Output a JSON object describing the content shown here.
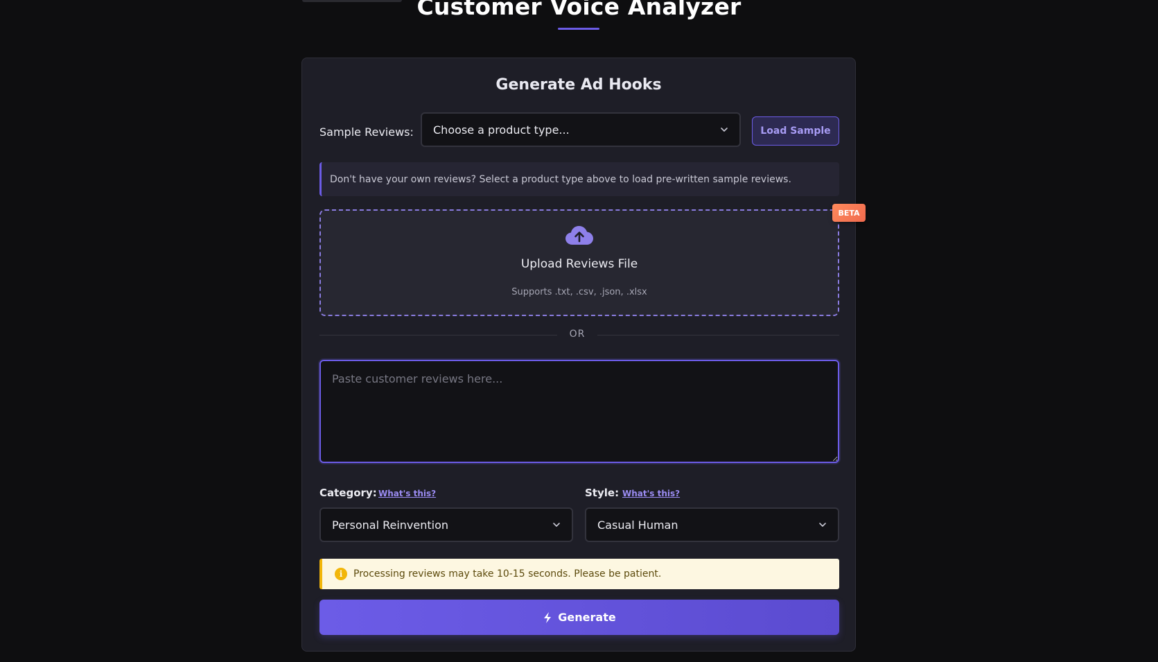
{
  "header": {
    "title": "Customer Voice Analyzer"
  },
  "card": {
    "title": "Generate Ad Hooks",
    "sample": {
      "label": "Sample Reviews:",
      "select_value": "Choose a product type...",
      "load_button": "Load Sample"
    },
    "info_text": "Don't have your own reviews? Select a product type above to load pre-written sample reviews.",
    "upload": {
      "icon": "cloud-upload-icon",
      "title": "Upload Reviews File",
      "subtitle": "Supports .txt, .csv, .json, .xlsx",
      "badge": "BETA"
    },
    "divider_text": "OR",
    "reviews_input": {
      "value": "",
      "placeholder": "Paste customer reviews here..."
    },
    "category": {
      "label": "Category:",
      "help_link": "What's this?",
      "selected": "Personal Reinvention"
    },
    "style": {
      "label": "Style:",
      "help_link": "What's this?",
      "selected": "Casual Human"
    },
    "warning": {
      "icon": "info-icon",
      "text": "Processing reviews may take 10-15 seconds. Please be patient."
    },
    "generate_button": {
      "icon": "bolt-icon",
      "label": "Generate"
    }
  },
  "colors": {
    "background": "#0e0e10",
    "card": "#1e1e27",
    "accent": "#6c5ce7",
    "warning_bg": "#fdf7e1",
    "warning_border": "#f2b60a",
    "beta_badge": "#f06a4e"
  }
}
